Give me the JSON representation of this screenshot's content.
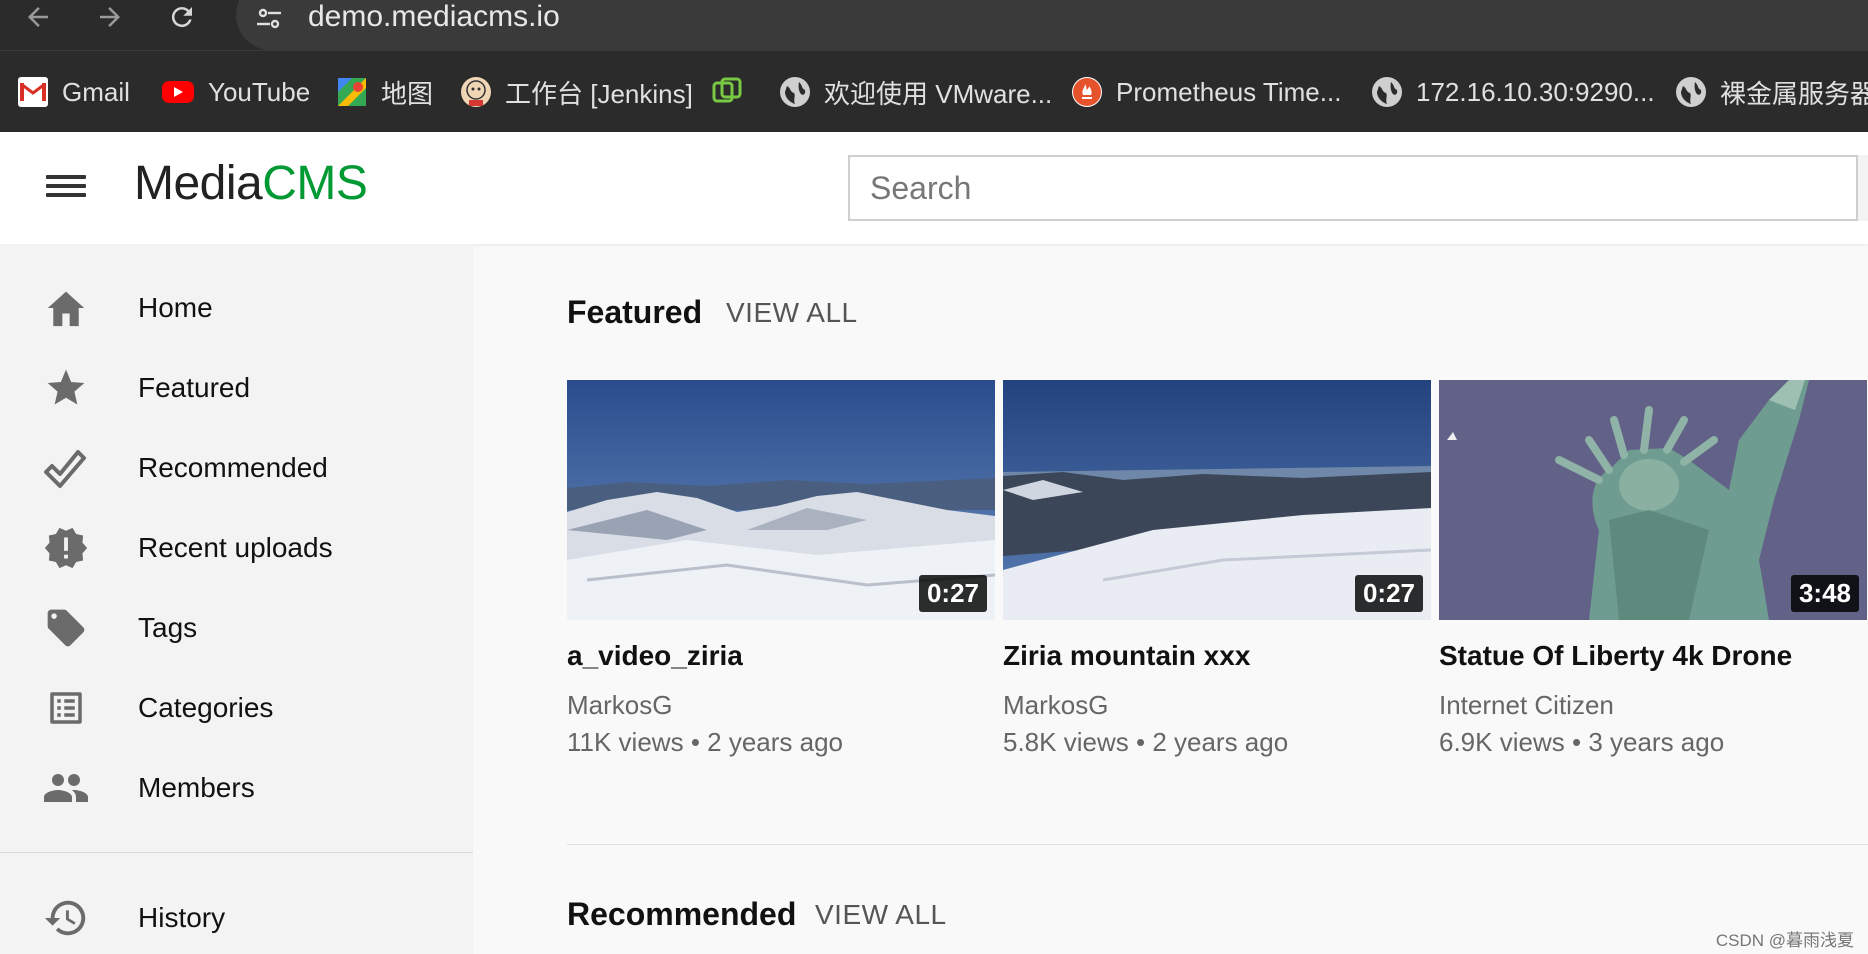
{
  "browser": {
    "url": "demo.mediacms.io",
    "bookmarks": [
      {
        "label": "Gmail",
        "icon": "gmail-icon"
      },
      {
        "label": "YouTube",
        "icon": "youtube-icon"
      },
      {
        "label": "地图",
        "icon": "maps-icon"
      },
      {
        "label": "工作台 [Jenkins]",
        "icon": "jenkins-icon"
      },
      {
        "label": "",
        "icon": "vmware-icon"
      },
      {
        "label": "欢迎使用 VMware...",
        "icon": "globe-icon"
      },
      {
        "label": "Prometheus Time...",
        "icon": "prometheus-icon"
      },
      {
        "label": "172.16.10.30:9290...",
        "icon": "globe-icon"
      },
      {
        "label": "裸金属服务器",
        "icon": "globe-icon"
      }
    ]
  },
  "header": {
    "logo_media": "Media",
    "logo_cms": "CMS",
    "search_placeholder": "Search",
    "accent_color": "#009933"
  },
  "sidebar": {
    "items": [
      {
        "label": "Home",
        "icon": "home-icon"
      },
      {
        "label": "Featured",
        "icon": "star-icon"
      },
      {
        "label": "Recommended",
        "icon": "check-icon"
      },
      {
        "label": "Recent uploads",
        "icon": "new-badge-icon"
      },
      {
        "label": "Tags",
        "icon": "tag-icon"
      },
      {
        "label": "Categories",
        "icon": "list-icon"
      },
      {
        "label": "Members",
        "icon": "people-icon"
      },
      {
        "label": "History",
        "icon": "history-icon"
      }
    ]
  },
  "main": {
    "featured": {
      "title": "Featured",
      "view_all": "VIEW ALL",
      "videos": [
        {
          "title": "a_video_ziria",
          "author": "MarkosG",
          "views": "11K views",
          "age": "2 years ago",
          "duration": "0:27"
        },
        {
          "title": "Ziria mountain xxx",
          "author": "MarkosG",
          "views": "5.8K views",
          "age": "2 years ago",
          "duration": "0:27"
        },
        {
          "title": "Statue Of Liberty 4k Drone",
          "author": "Internet Citizen",
          "views": "6.9K views",
          "age": "3 years ago",
          "duration": "3:48"
        }
      ]
    },
    "recommended": {
      "title": "Recommended",
      "view_all": "VIEW ALL"
    },
    "meta_separator": "•"
  },
  "watermark": "CSDN @暮雨浅夏"
}
